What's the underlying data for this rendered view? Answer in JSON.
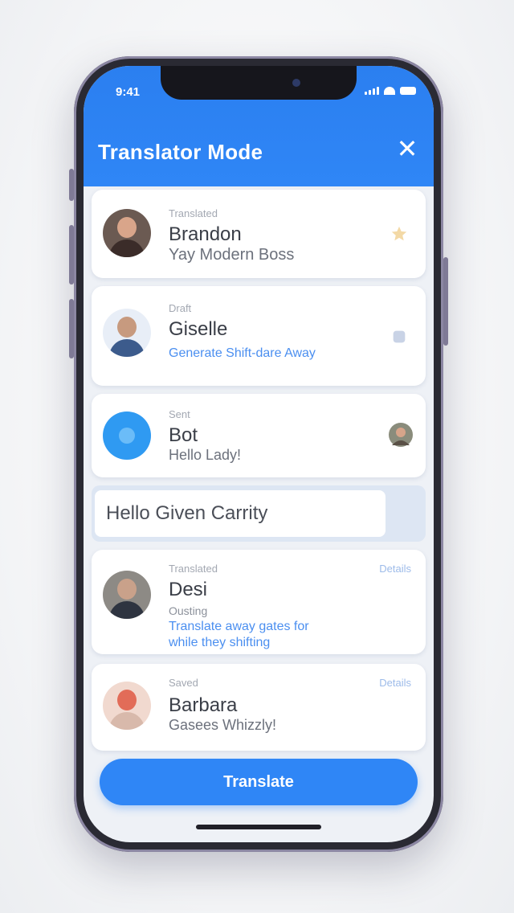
{
  "status_bar": {
    "time": "9:41"
  },
  "header": {
    "title": "Translator Mode",
    "close_glyph": "✕"
  },
  "contacts": [
    {
      "meta": "Translated",
      "name": "Brandon",
      "detail": "Yay Modern Boss",
      "right_icon": "star-icon",
      "avatar_colors": {
        "bg": "#6b5a52",
        "head": "#d9a58a",
        "body": "#3b2c29"
      }
    },
    {
      "meta": "Draft",
      "name": "Giselle",
      "detail": "Generate Shift-dare Away",
      "right_icon": "more-icon",
      "avatar_colors": {
        "bg": "#e8eef7",
        "head": "#c79a7f",
        "body": "#3c5b8c"
      }
    },
    {
      "meta": "Sent",
      "name": "Bot",
      "detail": "Hello Lady!",
      "right_icon": "avatar-mini-icon",
      "avatar_colors": {
        "bg": "#2f9af2",
        "head": "#2f9af2",
        "body": "#2f9af2"
      }
    },
    {
      "meta": "Translated",
      "name": "Desi",
      "detail": "Ousting",
      "link": "Translate away gates for while they shifting",
      "right_link": "Details",
      "avatar_colors": {
        "bg": "#8d8a85",
        "head": "#c9a18a",
        "body": "#2e3440"
      }
    },
    {
      "meta": "Saved",
      "name": "Barbara",
      "detail": "Gasees Whizzly!",
      "right_link": "Details",
      "avatar_colors": {
        "bg": "#f1d9cf",
        "head": "#e26c58",
        "body": "#d8b9ab"
      }
    }
  ],
  "input": {
    "value": "Hello Given Carrity"
  },
  "primary_button": {
    "label": "Translate"
  },
  "colors": {
    "accent": "#2f86f6",
    "link": "#4b8ff0",
    "card": "#ffffff",
    "screen_bg": "#eef1f6"
  }
}
